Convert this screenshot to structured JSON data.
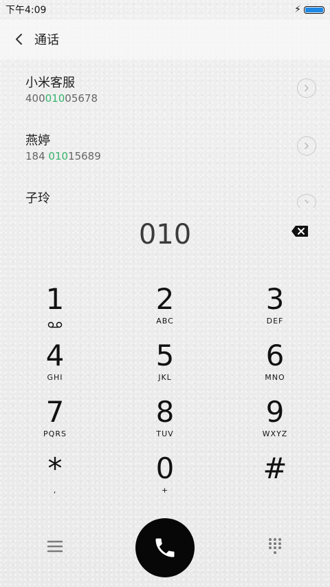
{
  "status_bar": {
    "time": "下午4:09",
    "charging_icon": "bolt-icon",
    "battery_icon": "battery-icon",
    "battery_level": 1.0,
    "battery_color": "#1e88e5"
  },
  "header": {
    "back_icon": "chevron-left-icon",
    "title": "通话"
  },
  "results": [
    {
      "name": "小米客服",
      "number_prefix": "400",
      "number_match": "010",
      "number_suffix": "05678"
    },
    {
      "name": "燕婷",
      "number_prefix": "184 ",
      "number_match": "010",
      "number_suffix": "15689"
    },
    {
      "name": "子玲"
    }
  ],
  "dialed_number": "010",
  "delete_icon": "backspace-icon",
  "keypad": [
    {
      "digit": "1",
      "letters": ""
    },
    {
      "digit": "2",
      "letters": "ABC"
    },
    {
      "digit": "3",
      "letters": "DEF"
    },
    {
      "digit": "4",
      "letters": "GHI"
    },
    {
      "digit": "5",
      "letters": "JKL"
    },
    {
      "digit": "6",
      "letters": "MNO"
    },
    {
      "digit": "7",
      "letters": "PQRS"
    },
    {
      "digit": "8",
      "letters": "TUV"
    },
    {
      "digit": "9",
      "letters": "WXYZ"
    },
    {
      "digit": "*",
      "letters": ","
    },
    {
      "digit": "0",
      "letters": "+"
    },
    {
      "digit": "#",
      "letters": ""
    }
  ],
  "bottom_bar": {
    "menu_icon": "menu-icon",
    "call_icon": "phone-icon",
    "dialpad_icon": "dialpad-icon"
  },
  "colors": {
    "highlight": "#35b36b",
    "call_button": "#070707"
  }
}
